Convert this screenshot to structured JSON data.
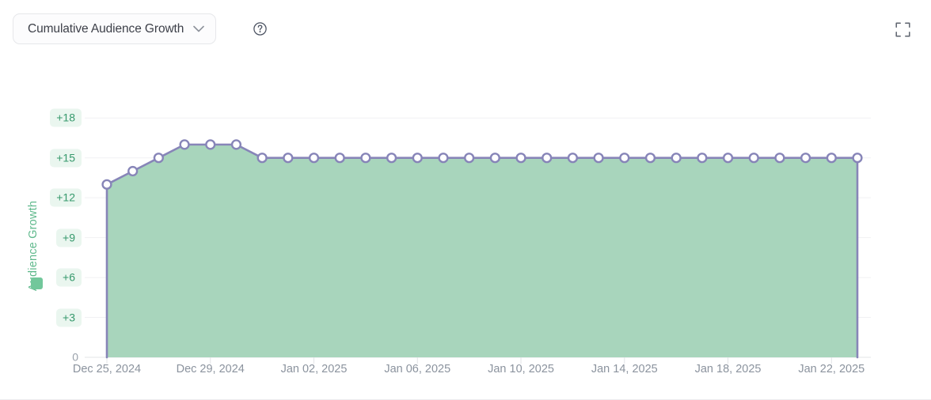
{
  "header": {
    "metric_select_label": "Cumulative Audience Growth",
    "chevron_icon": "chevron-down-icon",
    "help_icon": "help-circle-icon",
    "fullscreen_icon": "fullscreen-expand-icon"
  },
  "colors": {
    "line": "#8785b8",
    "area_fill": "#a8d5bc",
    "marker_fill": "#ffffff",
    "marker_stroke": "#8785b8",
    "axis_label_green": "#36996c",
    "axis_pill_bg": "#eaf6ef",
    "legend_swatch": "#72c79b",
    "grid": "#f1f1f3",
    "x_tick_text": "#8b939e",
    "y_axis_title": "#5fb98c",
    "select_border": "#e6e7ea",
    "select_bg": "#fcfcfd",
    "select_text": "#3d4049"
  },
  "chart_data": {
    "type": "area",
    "title": "Cumulative Audience Growth",
    "xlabel": "",
    "ylabel": "Audience Growth",
    "ylim": [
      0,
      19.5
    ],
    "grid": true,
    "legend_position": "left",
    "y_ticks": [
      0,
      3,
      6,
      9,
      12,
      15,
      18
    ],
    "y_tick_labels": [
      "0",
      "+3",
      "+6",
      "+9",
      "+12",
      "+15",
      "+18"
    ],
    "x_tick_labels": [
      "Dec 25, 2024",
      "Dec 29, 2024",
      "Jan 02, 2025",
      "Jan 06, 2025",
      "Jan 10, 2025",
      "Jan 14, 2025",
      "Jan 18, 2025",
      "Jan 22, 2025"
    ],
    "x_tick_indices": [
      0,
      4,
      8,
      12,
      16,
      20,
      24,
      28
    ],
    "series": [
      {
        "name": "Audience Growth",
        "x": [
          "Dec 25, 2024",
          "Dec 26, 2024",
          "Dec 27, 2024",
          "Dec 28, 2024",
          "Dec 29, 2024",
          "Dec 30, 2024",
          "Dec 31, 2024",
          "Jan 01, 2025",
          "Jan 02, 2025",
          "Jan 03, 2025",
          "Jan 04, 2025",
          "Jan 05, 2025",
          "Jan 06, 2025",
          "Jan 07, 2025",
          "Jan 08, 2025",
          "Jan 09, 2025",
          "Jan 10, 2025",
          "Jan 11, 2025",
          "Jan 12, 2025",
          "Jan 13, 2025",
          "Jan 14, 2025",
          "Jan 15, 2025",
          "Jan 16, 2025",
          "Jan 17, 2025",
          "Jan 18, 2025",
          "Jan 19, 2025",
          "Jan 20, 2025",
          "Jan 21, 2025",
          "Jan 22, 2025",
          "Jan 23, 2025"
        ],
        "values": [
          13,
          14,
          15,
          16,
          16,
          16,
          15,
          15,
          15,
          15,
          15,
          15,
          15,
          15,
          15,
          15,
          15,
          15,
          15,
          15,
          15,
          15,
          15,
          15,
          15,
          15,
          15,
          15,
          15,
          15
        ]
      }
    ]
  }
}
